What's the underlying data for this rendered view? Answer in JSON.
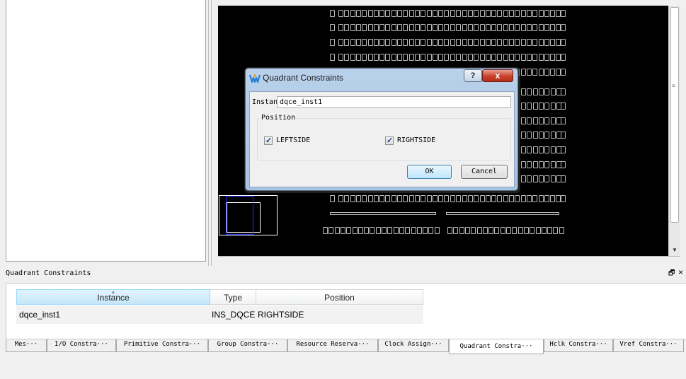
{
  "dialog": {
    "title": "Quadrant Constraints",
    "help_label": "?",
    "close_label": "x",
    "instance_label": "Instance",
    "instance_value": "dqce_inst1",
    "position_group_label": "Position",
    "leftside_label": "LEFTSIDE",
    "leftside_checked": true,
    "rightside_label": "RIGHTSIDE",
    "rightside_checked": true,
    "check_mark": "✓",
    "ok_label": "OK",
    "cancel_label": "Cancel"
  },
  "pane": {
    "title": "Quadrant Constraints",
    "float_glyph": "🗗",
    "close_glyph": "×"
  },
  "table": {
    "columns": [
      "Instance",
      "Type",
      "Position"
    ],
    "sorted_column": "Instance",
    "rows": [
      [
        "dqce_inst1",
        "INS_DQCE",
        "RIGHTSIDE"
      ]
    ]
  },
  "tabs": [
    {
      "label": "Mes···",
      "active": false
    },
    {
      "label": "I/O Constra···",
      "active": false
    },
    {
      "label": "Primitive Constra···",
      "active": false
    },
    {
      "label": "Group Constra···",
      "active": false
    },
    {
      "label": "Resource Reserva···",
      "active": false
    },
    {
      "label": "Clock Assign···",
      "active": false
    },
    {
      "label": "Quadrant Constra···",
      "active": true
    },
    {
      "label": "Hclk Constra···",
      "active": false
    },
    {
      "label": "Vref Constra···",
      "active": false
    }
  ],
  "colors": {
    "chip_background": "#000000",
    "pad_outline": "#bbbbbb",
    "overview_highlight": "#2030ff"
  }
}
